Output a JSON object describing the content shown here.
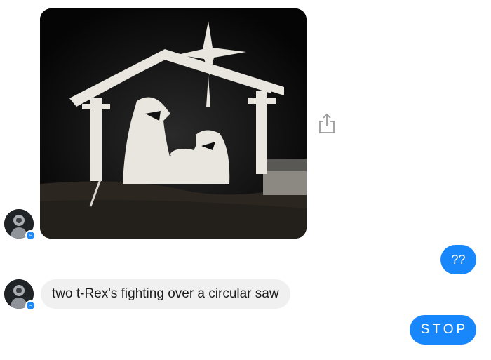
{
  "conversation": {
    "messages": [
      {
        "sender": "them",
        "type": "image",
        "image_subject": "wooden nativity scene silhouette lit at night"
      },
      {
        "sender": "me",
        "type": "text",
        "text": "??"
      },
      {
        "sender": "them",
        "type": "text",
        "text": "two t-Rex's fighting over a circular saw"
      },
      {
        "sender": "me",
        "type": "text",
        "text": "STOP"
      }
    ],
    "incoming_bubble_color": "#f1f0f0",
    "outgoing_bubble_color": "#1787fb",
    "badge_color": "#1e88f5"
  },
  "icons": {
    "share": "share-icon",
    "messenger_badge": "messenger-badge-icon"
  }
}
